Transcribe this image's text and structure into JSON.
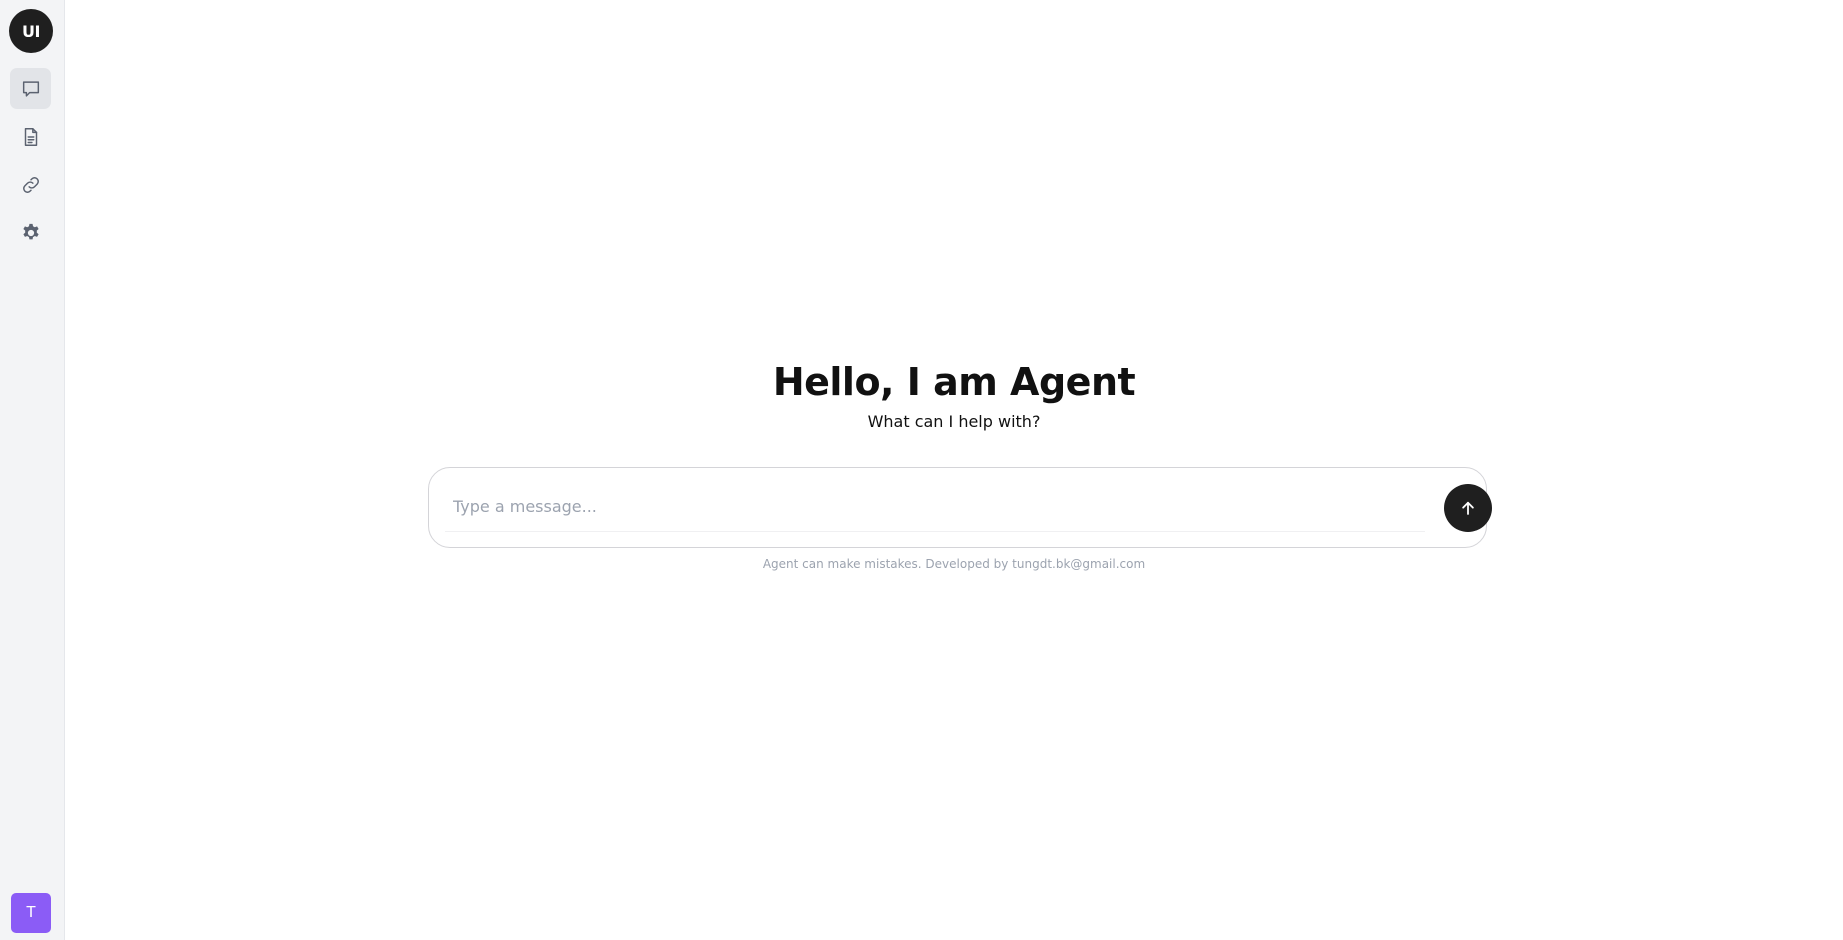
{
  "sidebar": {
    "logo_text": "UI",
    "items": [
      {
        "name": "chat",
        "icon": "chat-bubble-icon",
        "active": true
      },
      {
        "name": "documents",
        "icon": "document-icon",
        "active": false
      },
      {
        "name": "links",
        "icon": "link-icon",
        "active": false
      },
      {
        "name": "settings",
        "icon": "gear-icon",
        "active": false
      }
    ],
    "user_initial": "T",
    "user_avatar_color": "#8b5cf6"
  },
  "main": {
    "heading": "Hello, I am Agent",
    "subheading": "What can I help with?",
    "composer": {
      "placeholder": "Type a message...",
      "value": ""
    },
    "send_icon": "arrow-up-icon",
    "disclaimer": "Agent can make mistakes. Developed by tungdt.bk@gmail.com"
  },
  "colors": {
    "sidebar_bg": "#f3f4f6",
    "accent_dark": "#1f1f1f",
    "muted_text": "#9ca3af"
  }
}
